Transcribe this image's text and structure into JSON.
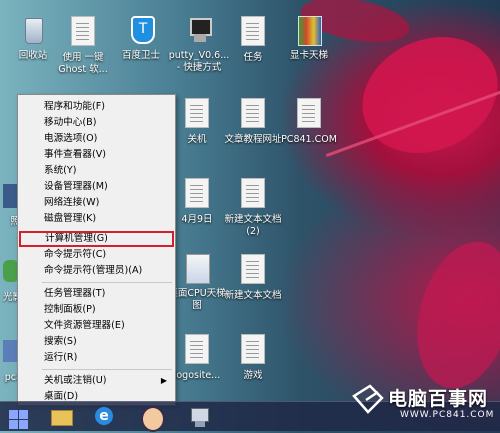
{
  "desktop_icons": [
    {
      "id": "recycle",
      "label": "回收站"
    },
    {
      "id": "ghost",
      "label": "使用 一键 Ghost 软..."
    },
    {
      "id": "baidu",
      "label": "百度卫士"
    },
    {
      "id": "putty",
      "label": "putty_V0.6... - 快捷方式"
    },
    {
      "id": "task",
      "label": "任务"
    },
    {
      "id": "gpu",
      "label": "显卡天梯"
    },
    {
      "id": "shutdown",
      "label": "关机"
    },
    {
      "id": "tutorial",
      "label": "文章教程网址"
    },
    {
      "id": "pc841",
      "label": "PC841.COM"
    },
    {
      "id": "apr9",
      "label": "4月9日"
    },
    {
      "id": "newtxt2",
      "label": "新建文本文档 (2)"
    },
    {
      "id": "cpu",
      "label": "桌面CPU天梯图"
    },
    {
      "id": "newtxt",
      "label": "新建文本文档"
    },
    {
      "id": "logosite",
      "label": "logosite..."
    },
    {
      "id": "game",
      "label": "游戏"
    }
  ],
  "partial_icons": [
    {
      "id": "p1",
      "label": "照"
    },
    {
      "id": "p2",
      "label": "光影"
    },
    {
      "id": "p3",
      "label": "pc8"
    }
  ],
  "context_menu": {
    "items": [
      {
        "label": "程序和功能(F)"
      },
      {
        "label": "移动中心(B)"
      },
      {
        "label": "电源选项(O)"
      },
      {
        "label": "事件查看器(V)"
      },
      {
        "label": "系统(Y)"
      },
      {
        "label": "设备管理器(M)"
      },
      {
        "label": "网络连接(W)"
      },
      {
        "label": "磁盘管理(K)"
      },
      {
        "label": "计算机管理(G)"
      },
      {
        "label": "命令提示符(C)"
      },
      {
        "label": "命令提示符(管理员)(A)"
      },
      {
        "label": "任务管理器(T)"
      },
      {
        "label": "控制面板(P)"
      },
      {
        "label": "文件资源管理器(E)"
      },
      {
        "label": "搜索(S)"
      },
      {
        "label": "运行(R)"
      },
      {
        "label": "关机或注销(U)"
      },
      {
        "label": "桌面(D)"
      }
    ],
    "highlight_color": "#d4202a"
  },
  "watermark": {
    "brand": "电脑百事网",
    "url": "WWW.PC841.COM"
  },
  "colors": {
    "start": "#8aa6ff",
    "accent": "#c8184e"
  }
}
